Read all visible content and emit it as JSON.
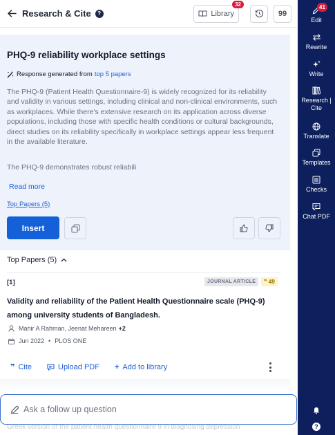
{
  "header": {
    "title": "Research & Cite",
    "help_icon": "?",
    "library_label": "Library",
    "library_badge": "32",
    "quote_icon_label": "99"
  },
  "answer": {
    "title": "PHQ-9 reliability workplace settings",
    "generated_prefix": "Response generated from",
    "generated_link": "top 5 papers",
    "paragraph1": "The PHQ-9 (Patient Health Questionnaire-9) is widely recognized for its reliability and validity in various settings, including clinical and non-clinical environments, such as workplaces. While there's extensive research on its application across diverse populations, including those with specific health conditions or cultural backgrounds, direct studies on its reliability specifically in workplace settings appear less frequent in the available literature.",
    "paragraph2": "The PHQ-9 demonstrates robust reliabili",
    "read_more": "Read more",
    "top_papers_link": "Top Papers (5)",
    "insert_label": "Insert"
  },
  "top_papers": {
    "header": "Top Papers (5)",
    "papers": [
      {
        "number": "[1]",
        "type_badge": "JOURNAL ARTICLE",
        "citations": "49",
        "title": "Validity and reliability of the Patient Health Questionnaire scale (PHQ-9) among university students of Bangladesh.",
        "authors": "Mahir A Rahman, Jeenat Mehareen",
        "authors_more": "+2",
        "date": "Jun 2022",
        "journal": "PLOS ONE"
      }
    ],
    "actions": {
      "cite": "Cite",
      "upload_pdf": "Upload PDF",
      "add_to_library": "Add to library"
    },
    "behind_text": "Greek version of the patient health questionnaire 9 in diagnosing depression"
  },
  "followup": {
    "placeholder": "Ask a follow up question"
  },
  "sidebar": {
    "items": [
      {
        "label": "Edit",
        "icon": "pencil-icon",
        "badge": "41"
      },
      {
        "label": "Rewrite",
        "icon": "rewrite-icon"
      },
      {
        "label": "Write",
        "icon": "sparkle-icon"
      },
      {
        "label": "Research | Cite",
        "icon": "books-icon"
      },
      {
        "label": "Translate",
        "icon": "globe-icon"
      },
      {
        "label": "Templates",
        "icon": "templates-icon"
      },
      {
        "label": "Checks",
        "icon": "checklist-icon"
      },
      {
        "label": "Chat PDF",
        "icon": "chat-icon"
      }
    ],
    "bell_icon": "bell-icon",
    "help_label": "?"
  },
  "colors": {
    "sidebar_bg": "#0d1f5c",
    "accent": "#1360d8",
    "answer_bg": "#eef2fb",
    "badge_red": "#d91c3c"
  }
}
